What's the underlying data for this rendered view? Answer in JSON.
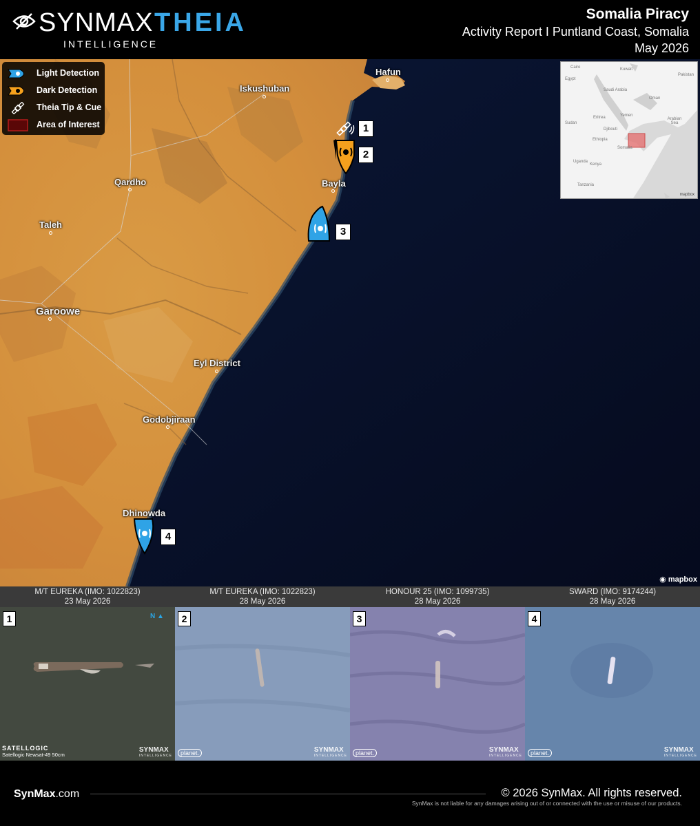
{
  "header": {
    "brand_main": "SYNMAX",
    "brand_accent": "THEIA",
    "brand_sub": "INTELLIGENCE",
    "title": "Somalia Piracy",
    "subtitle": "Activity Report I Puntland Coast, Somalia",
    "date": "May 2026"
  },
  "legend": [
    {
      "label": "Light Detection",
      "icon": "light-detection-icon",
      "color": "#2fa3e6"
    },
    {
      "label": "Dark Detection",
      "icon": "dark-detection-icon",
      "color": "#f5a01d"
    },
    {
      "label": "Theia Tip & Cue",
      "icon": "satellite-icon",
      "color": "#ffffff"
    },
    {
      "label": "Area of Interest",
      "icon": "area-of-interest-icon",
      "color": "#7a0a0a"
    }
  ],
  "places": {
    "hafun": "Hafun",
    "iskushuban": "Iskushuban",
    "qardho": "Qardho",
    "bayla": "Bayla",
    "taleh": "Taleh",
    "garoowe": "Garoowe",
    "eyl": "Eyl District",
    "godobjiraan": "Godobjiraan",
    "dhinowda": "Dhinowda"
  },
  "inset": {
    "labels": [
      "Cairo",
      "Egypt",
      "Kuwait",
      "Pakistan",
      "Saudi Arabia",
      "Oman",
      "Sudan",
      "Eritrea",
      "Yemen",
      "Arabian Sea",
      "Djibouti",
      "Ethiopia",
      "Somalia",
      "Uganda",
      "Kenya",
      "Tanzania"
    ],
    "attribution": "mapbox"
  },
  "markers": [
    {
      "num": "1",
      "type": "tip-cue"
    },
    {
      "num": "2",
      "type": "dark"
    },
    {
      "num": "3",
      "type": "light"
    },
    {
      "num": "4",
      "type": "light"
    }
  ],
  "map_attribution": "mapbox",
  "panels": [
    {
      "num": "1",
      "vessel": "M/T EUREKA (IMO: 1022823)",
      "date": "23 May 2026",
      "source": "SATELLOGIC",
      "source_detail": "Satellogic Newsat-49 50cm",
      "wm": "SYNMAX",
      "wm_sub": "INTELLIGENCE"
    },
    {
      "num": "2",
      "vessel": "M/T EUREKA (IMO: 1022823)",
      "date": "28 May 2026",
      "source": "planet.",
      "wm": "SYNMAX",
      "wm_sub": "INTELLIGENCE"
    },
    {
      "num": "3",
      "vessel": "HONOUR 25 (IMO: 1099735)",
      "date": "28 May 2026",
      "source": "planet.",
      "wm": "SYNMAX",
      "wm_sub": "INTELLIGENCE"
    },
    {
      "num": "4",
      "vessel": "SWARD (IMO: 9174244)",
      "date": "28 May 2026",
      "source": "planet.",
      "wm": "SYNMAX",
      "wm_sub": "INTELLIGENCE"
    }
  ],
  "footer": {
    "site_bold": "SynMax",
    "site_rest": ".com",
    "copyright": "© 2026 SynMax. All rights reserved.",
    "disclaimer": "SynMax is not liable for any damages arising out of or connected with the use or misuse of our products."
  }
}
